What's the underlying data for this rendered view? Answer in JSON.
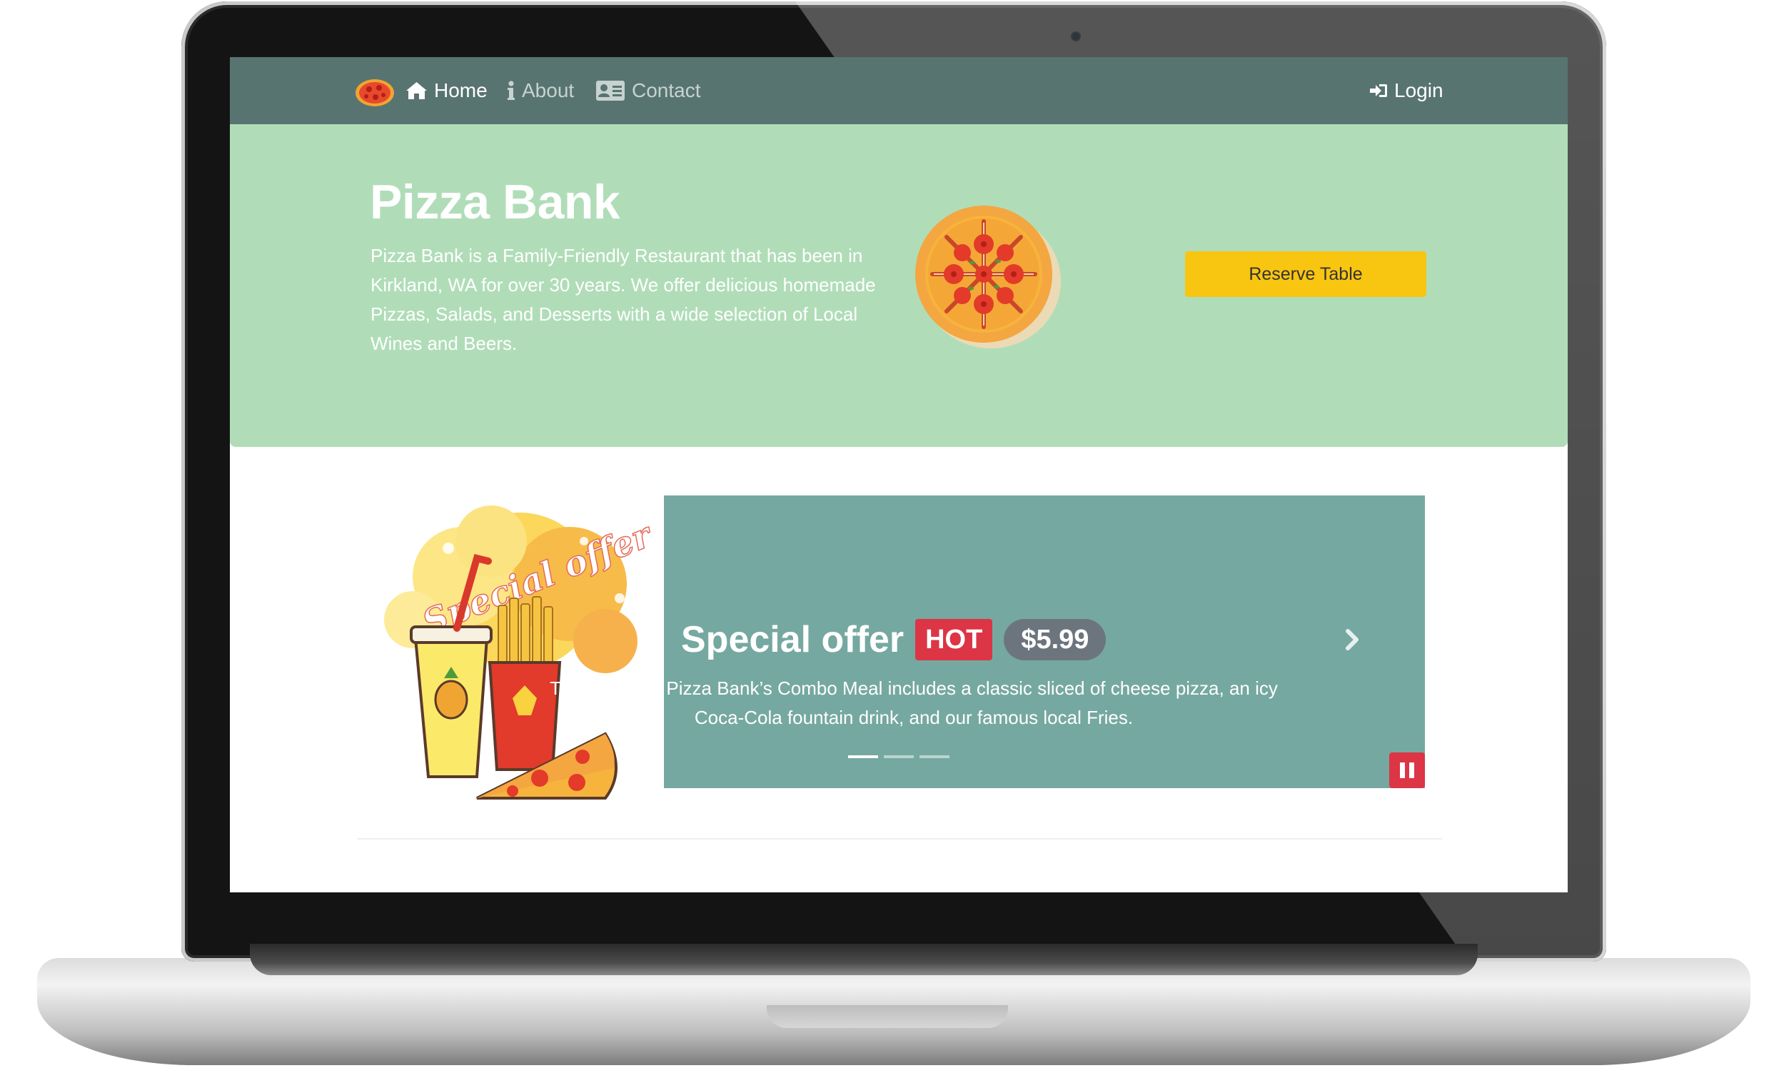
{
  "navbar": {
    "brand_icon": "pizza-logo",
    "items": [
      {
        "label": "Home",
        "icon": "home-icon",
        "active": true
      },
      {
        "label": "About",
        "icon": "info-icon",
        "active": false
      },
      {
        "label": "Contact",
        "icon": "address-card-icon",
        "active": false
      }
    ],
    "login": {
      "label": "Login",
      "icon": "sign-in-icon"
    }
  },
  "jumbotron": {
    "title": "Pizza Bank",
    "text": "Pizza Bank is a Family-Friendly Restaurant that has been in Kirkland, WA for over 30 years. We offer delicious homemade Pizzas, Salads, and Desserts with a wide selection of Local Wines and Beers.",
    "image": "pizza-illustration",
    "button_label": "Reserve Table"
  },
  "promo": {
    "image": "special-offer-combo-illustration",
    "image_text": "Special offer"
  },
  "carousel": {
    "title": "Special offer",
    "badge_hot": "HOT",
    "badge_price": "$5.99",
    "caption": "The best sold Pizza Bank’s Combo Meal includes a classic sliced of cheese pizza, an icy Coca-Cola fountain drink, and our famous local Fries.",
    "indicator_count": 3,
    "active_index": 0,
    "next_icon": "chevron-right-icon",
    "pause_icon": "pause-icon"
  },
  "colors": {
    "navbar": "#587470",
    "jumbotron": "#b0ddb8",
    "reserve_button": "#f8c511",
    "carousel": "#75a8a1",
    "hot_badge": "#dc3545",
    "price_badge": "#6c757d",
    "pause_button": "#dc3545"
  }
}
